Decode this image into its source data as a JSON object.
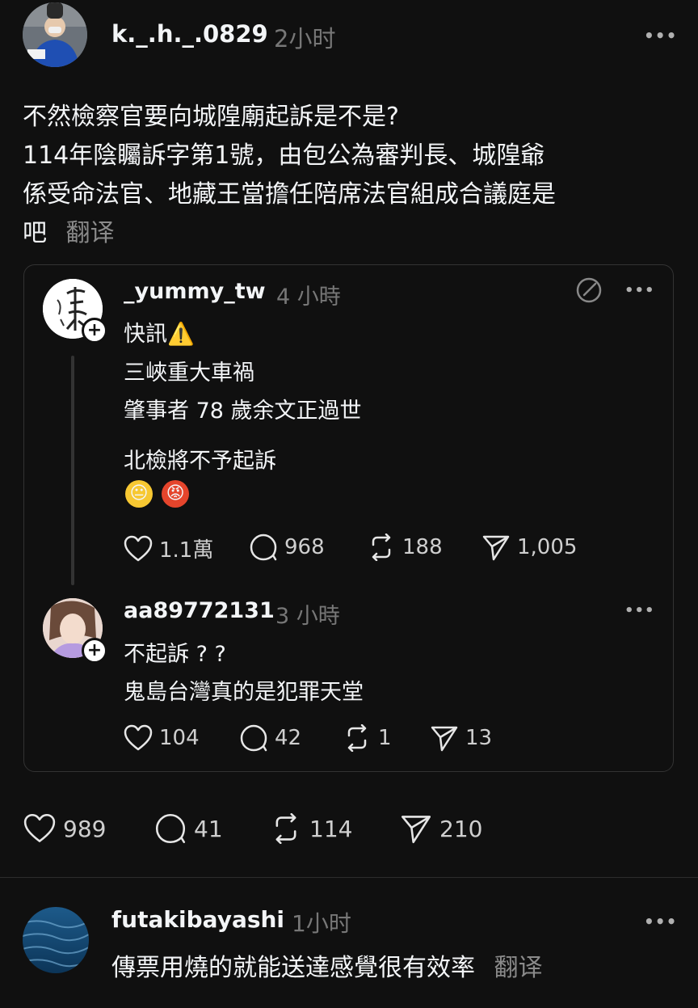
{
  "post": {
    "username": "k._.h._.0829",
    "time": "2小时",
    "more": "•••",
    "lines": [
      "不然檢察官要向城隍廟起訴是不是?",
      "114年陰矚訴字第1號，由包公為審判長、城隍爺",
      "係受命法官、地藏王當擔任陪席法官組成合議庭是",
      "吧"
    ],
    "translate": "翻译",
    "metrics": {
      "likes": "989",
      "comments": "41",
      "reposts": "114",
      "shares": "210"
    }
  },
  "quoted": {
    "username": "_yummy_tw",
    "time": "4 小時",
    "more": "•••",
    "plus": "+",
    "lines": [
      "快訊⚠️",
      "三峽重大車禍",
      "肇事者 78 歲余文正過世",
      "北檢將不予起訴"
    ],
    "emojis": [
      "😐",
      "😡"
    ],
    "metrics": {
      "likes": "1.1萬",
      "comments": "968",
      "reposts": "188",
      "shares": "1,005"
    }
  },
  "reply": {
    "username": "aa89772131",
    "time": "3 小時",
    "more": "•••",
    "plus": "+",
    "lines": [
      "不起訴 ? ?",
      "鬼島台灣真的是犯罪天堂"
    ],
    "metrics": {
      "likes": "104",
      "comments": "42",
      "reposts": "1",
      "shares": "13"
    }
  },
  "comment": {
    "username": "futakibayashi",
    "time": "1小时",
    "more": "•••",
    "text": "傳票用燒的就能送達感覺很有效率",
    "translate": "翻译"
  },
  "colors": {
    "background": "#101010",
    "text": "#f3f5f7",
    "muted": "#777777",
    "border": "#333333"
  }
}
